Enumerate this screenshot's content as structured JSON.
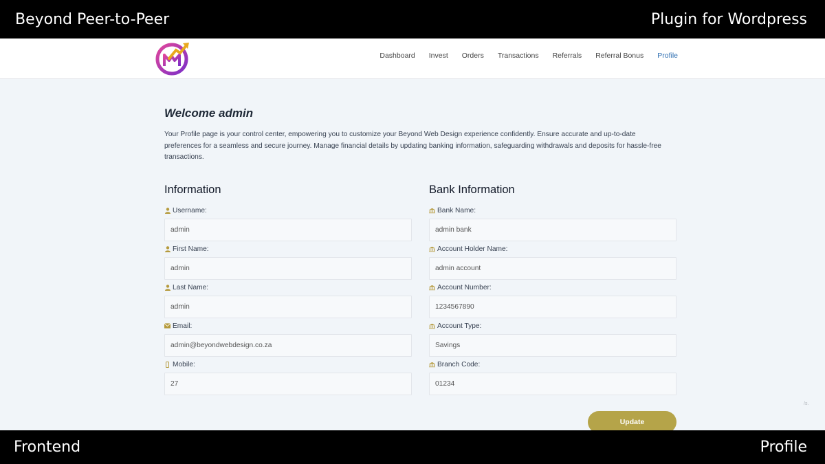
{
  "banner_top": {
    "left": "Beyond Peer-to-Peer",
    "right": "Plugin for Wordpress"
  },
  "banner_bottom": {
    "left": "Frontend",
    "right": "Profile"
  },
  "nav": {
    "items": [
      "Dashboard",
      "Invest",
      "Orders",
      "Transactions",
      "Referrals",
      "Referral Bonus",
      "Profile"
    ],
    "active": "Profile"
  },
  "page": {
    "welcome": "Welcome admin",
    "intro": "Your Profile page is your control center, empowering you to customize your Beyond Web Design experience confidently. Ensure accurate and up-to-date preferences for a seamless and secure journey. Manage financial details by updating banking information, safeguarding withdrawals and deposits for hassle-free transactions."
  },
  "info": {
    "heading": "Information",
    "username": {
      "label": "Username:",
      "value": "admin",
      "icon": "user-icon"
    },
    "first_name": {
      "label": "First Name:",
      "value": "admin",
      "icon": "user-icon"
    },
    "last_name": {
      "label": "Last Name:",
      "value": "admin",
      "icon": "user-icon"
    },
    "email": {
      "label": "Email:",
      "value": "admin@beyondwebdesign.co.za",
      "icon": "envelope-icon"
    },
    "mobile": {
      "label": "Mobile:",
      "value": "27",
      "icon": "mobile-icon"
    }
  },
  "bank": {
    "heading": "Bank Information",
    "bank_name": {
      "label": "Bank Name:",
      "value": "admin bank",
      "icon": "bank-icon"
    },
    "holder": {
      "label": "Account Holder Name:",
      "value": "admin account",
      "icon": "bank-icon"
    },
    "number": {
      "label": "Account Number:",
      "value": "1234567890",
      "icon": "bank-icon"
    },
    "type": {
      "label": "Account Type:",
      "value": "Savings",
      "icon": "bank-icon"
    },
    "branch": {
      "label": "Branch Code:",
      "value": "01234",
      "icon": "bank-icon"
    }
  },
  "update_label": "Update",
  "corner_text": "/s.",
  "colors": {
    "accent_gold": "#b5a449",
    "active_link": "#2b6cb0",
    "page_bg": "#f1f5f9"
  }
}
